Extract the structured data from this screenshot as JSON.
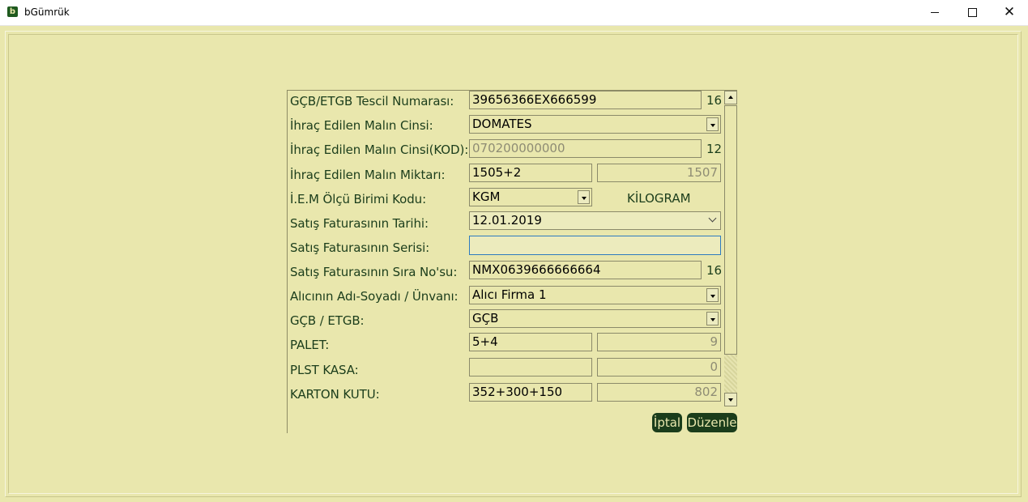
{
  "window": {
    "title": "bGümrük",
    "icon": "app-icon",
    "icon_glyph": "b",
    "controls": [
      "minimize-icon",
      "maximize-icon",
      "close-icon"
    ]
  },
  "form": {
    "rows": [
      {
        "label": "GÇB/ETGB Tescil Numarası:",
        "value": "39656366EX666599",
        "count": "16"
      },
      {
        "label": "İhraç Edilen Malın Cinsi:",
        "value": "DOMATES"
      },
      {
        "label": "İhraç Edilen Malın Cinsi(KOD):",
        "value": "070200000000",
        "count": "12"
      },
      {
        "label": "İhraç Edilen Malın Miktarı:",
        "value": "1505+2",
        "total": "1507"
      },
      {
        "label": "İ.E.M Ölçü Birimi Kodu:",
        "value": "KGM",
        "unit_name": "KİLOGRAM"
      },
      {
        "label": "Satış Faturasının Tarihi:",
        "value": "12.01.2019"
      },
      {
        "label": "Satış Faturasının Serisi:",
        "value": ""
      },
      {
        "label": "Satış Faturasının Sıra No'su:",
        "value": "NMX0639666666664",
        "count": "16"
      },
      {
        "label": "Alıcının Adı-Soyadı / Ünvanı:",
        "value": "Alıcı Firma 1"
      },
      {
        "label": "GÇB / ETGB:",
        "value": "GÇB"
      },
      {
        "label": "PALET:",
        "value": "5+4",
        "total": "9"
      },
      {
        "label": "PLST KASA:",
        "value": "",
        "total": "0"
      },
      {
        "label": "KARTON KUTU:",
        "value": "352+300+150",
        "total": "802"
      }
    ]
  },
  "buttons": {
    "cancel": "İptal",
    "edit": "Düzenle"
  },
  "colors": {
    "background": "#e9e7ad",
    "label_text": "#1b3d1b",
    "button_bg": "#1b3d1b",
    "button_text": "#e9e7ad",
    "focus_border": "#2d7bbf"
  }
}
